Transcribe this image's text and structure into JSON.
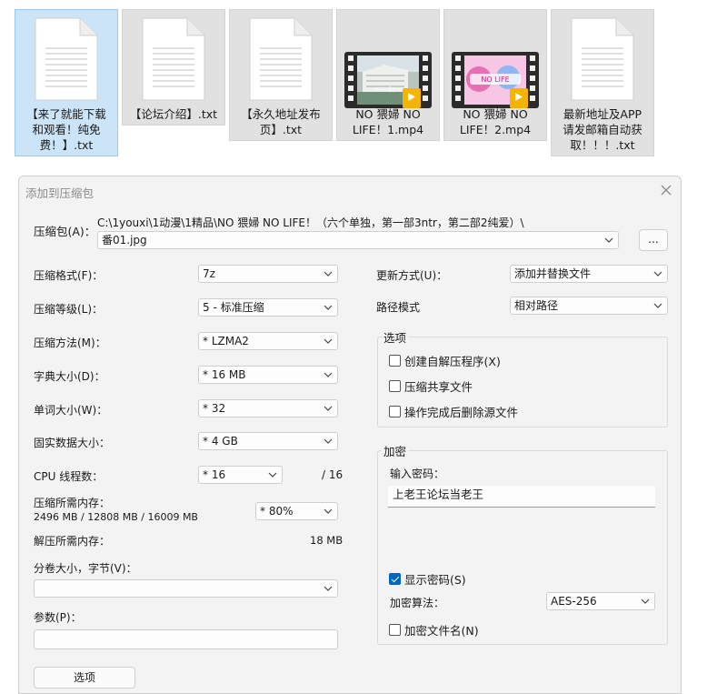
{
  "files": [
    {
      "name": "【来了就能下载和观看！纯免费！】.txt",
      "lines": [
        "【来了就能下载",
        "和观看！纯免",
        "费！】.txt"
      ],
      "type": "text",
      "selected": true
    },
    {
      "name": "【论坛介绍】.txt",
      "lines": [
        "【论坛介绍】.txt"
      ],
      "type": "text",
      "selected": false
    },
    {
      "name": "【永久地址发布页】.txt",
      "lines": [
        "【永久地址发布",
        "页】.txt"
      ],
      "type": "text",
      "selected": false
    },
    {
      "name": "NO 猥婦 NO LIFE! 1.mp4",
      "lines": [
        "NO 猥婦 NO",
        "LIFE！1.mp4"
      ],
      "type": "video",
      "selected": false
    },
    {
      "name": "NO 猥婦 NO LIFE! 2.mp4",
      "lines": [
        "NO 猥婦 NO",
        "LIFE！2.mp4"
      ],
      "type": "video",
      "selected": false
    },
    {
      "name": "最新地址及APP请发邮箱自动获取！！！.txt",
      "lines": [
        "最新地址及APP",
        "请发邮箱自动获",
        "取！！！.txt"
      ],
      "type": "text",
      "selected": false
    }
  ],
  "video_badge": "Player",
  "dialog": {
    "title": "添加到压缩包",
    "archive_label": "压缩包(A)：",
    "archive_path": "C:\\1youxi\\1动漫\\1精品\\NO 猥婦 NO LIFE！（六个单独，第一部3ntr，第二部2纯爱）\\",
    "archive_name": "番01.jpg",
    "browse_label": "...",
    "format_label": "压缩格式(F)：",
    "format_value": "7z",
    "level_label": "压缩等级(L)：",
    "level_value": "5 - 标准压缩",
    "method_label": "压缩方法(M)：",
    "method_value": "* LZMA2",
    "dict_label": "字典大小(D)：",
    "dict_value": "* 16 MB",
    "word_label": "单词大小(W)：",
    "word_value": "* 32",
    "solid_label": "固实数据大小：",
    "solid_value": "* 4 GB",
    "cpu_label": "CPU 线程数：",
    "cpu_value": "* 16",
    "cpu_total": "/ 16",
    "mem_comp_label": "压缩所需内存：",
    "mem_comp_detail": "2496 MB / 12808 MB / 16009 MB",
    "mem_percent": "* 80%",
    "mem_decomp_label": "解压所需内存：",
    "mem_decomp_value": "18 MB",
    "volume_label": "分卷大小，字节(V)：",
    "volume_value": "",
    "params_label": "参数(P)：",
    "params_value": "",
    "options_button": "选项",
    "update_label": "更新方式(U)：",
    "update_value": "添加并替换文件",
    "path_label": "路径模式",
    "path_value": "相对路径",
    "options_group": "选项",
    "opt_sfx": "创建自解压程序(X)",
    "opt_shared": "压缩共享文件",
    "opt_delete": "操作完成后删除源文件",
    "encrypt_group": "加密",
    "password_label": "输入密码：",
    "password_value": "上老王论坛当老王",
    "show_password": "显示密码(S)",
    "enc_method_label": "加密算法：",
    "enc_method_value": "AES-256",
    "encrypt_names": "加密文件名(N)"
  }
}
